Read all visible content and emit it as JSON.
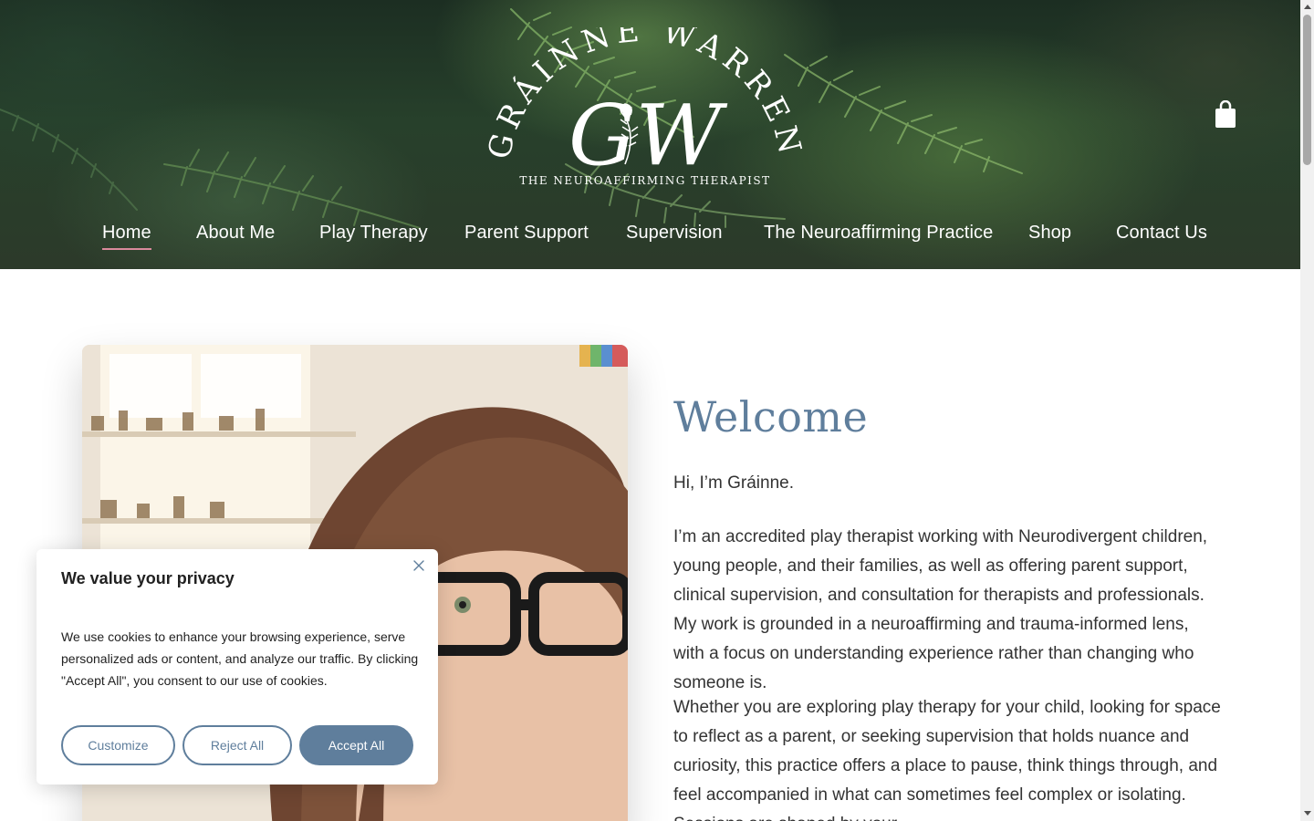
{
  "brand": {
    "arc_text": "GRÁINNE WARREN",
    "monogram": "GW",
    "tagline": "THE NEUROAFFIRMING THERAPIST"
  },
  "nav": {
    "items": [
      {
        "label": "Home",
        "active": true
      },
      {
        "label": "About Me",
        "active": false
      },
      {
        "label": "Play Therapy",
        "active": false
      },
      {
        "label": "Parent Support",
        "active": false
      },
      {
        "label": "Supervision",
        "active": false
      },
      {
        "label": "The Neuroaffirming Practice",
        "active": false
      },
      {
        "label": "Shop",
        "active": false
      },
      {
        "label": "Contact Us",
        "active": false
      }
    ]
  },
  "icons": {
    "cart": "shopping-bag-icon",
    "close": "close-icon"
  },
  "main": {
    "title": "Welcome",
    "greeting": "Hi, I’m Gráinne.",
    "paragraphs": [
      "I’m an accredited play therapist working with Neurodivergent children, young people, and their families, as well as offering parent support, clinical supervision, and consultation for therapists and professionals. My work is grounded in a neuroaffirming and trauma-informed lens, with a focus on understanding experience rather than changing who someone is.",
      "Whether you are exploring play therapy for your child, looking for space to reflect as a parent, or seeking supervision that holds nuance and curiosity, this practice offers a place to pause, think things through, and feel accompanied in what can sometimes feel complex or isolating. Sessions are shaped by your"
    ]
  },
  "cookie_banner": {
    "title": "We value your privacy",
    "text": "We use cookies to enhance your browsing experience, serve personalized ads or content, and analyze our traffic. By clicking \"Accept All\", you consent to our use of cookies.",
    "buttons": {
      "customize": "Customize",
      "reject": "Reject All",
      "accept": "Accept All"
    }
  },
  "colors": {
    "accent": "#5f7e9c",
    "nav_underline": "#d98a9c",
    "body_text": "#333333",
    "header_green": "#27402b"
  }
}
